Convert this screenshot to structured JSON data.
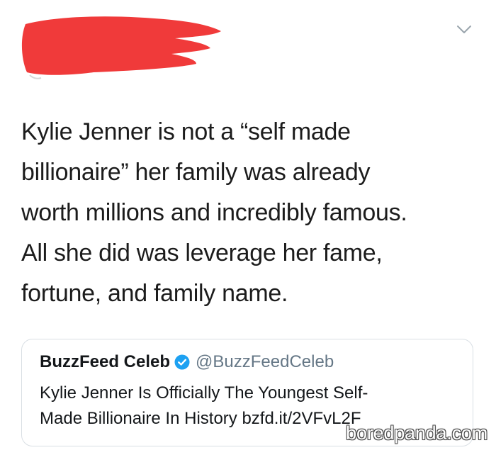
{
  "header": {
    "menu_icon": "chevron-down-icon",
    "redaction_color": "#f03a3a"
  },
  "tweet": {
    "text_lines": [
      "Kylie Jenner is not a “self made",
      "billionaire” her family was already",
      "worth millions and incredibly famous.",
      "All she did was leverage her fame,",
      "fortune, and family name."
    ]
  },
  "quoted_tweet": {
    "name": "BuzzFeed Celeb",
    "verified_icon": "verified-badge-icon",
    "handle": "@BuzzFeedCeleb",
    "text_lines": [
      "Kylie Jenner Is Officially The Youngest Self-",
      "Made Billionaire In History bzfd.it/2VFvL2F"
    ]
  },
  "watermark": {
    "text": "boredpanda.com"
  },
  "colors": {
    "text": "#1c1c1c",
    "handle": "#657786",
    "verified": "#1da1f2",
    "card_border": "#d9dfe4"
  }
}
